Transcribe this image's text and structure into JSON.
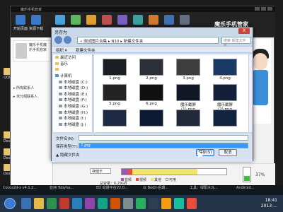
{
  "desktop": {
    "icons": [
      "Desk",
      "Desk",
      "Desk",
      "QQN"
    ]
  },
  "manager": {
    "topbar_text": "魔乐手机管家",
    "title": "魔乐手机管家",
    "tools": [
      "开始页面",
      "资源下载",
      "",
      "",
      "",
      "",
      "",
      "",
      "",
      "",
      ""
    ],
    "phone_card": "魔乐手机魔乐手机管家",
    "groups": [
      "所有联系人",
      "未分组联系人"
    ],
    "storage_select": "存储卡",
    "capacity_text": "总容量：6.29GB",
    "storage_legend": [
      "音频",
      "视频",
      "其他",
      "可用"
    ],
    "storage_colors": [
      "#9b59b6",
      "#e74c3c",
      "#f1e46b",
      "#ffffff"
    ],
    "battery_pct": "37%",
    "battery_level": 0.37
  },
  "dialog": {
    "title": "另存为",
    "close": "X",
    "address": "« 测试图片合集 ▸ N10 ▸ 新建文件夹",
    "search_placeholder": "搜索 新建文件夹",
    "organize": "组织 ▾",
    "new_folder": "新建文件夹",
    "nav_items": [
      {
        "label": "最近访问",
        "kind": "folder",
        "sub": false
      },
      {
        "label": "音乐",
        "kind": "folder",
        "sub": false
      },
      {
        "label": "",
        "kind": "folder",
        "sub": false
      },
      {
        "label": "计算机",
        "kind": "pc",
        "sub": false
      },
      {
        "label": "本地磁盘 (C:)",
        "kind": "drive",
        "sub": true
      },
      {
        "label": "本地磁盘 (D:)",
        "kind": "drive",
        "sub": true
      },
      {
        "label": "本地磁盘 (E:)",
        "kind": "drive",
        "sub": true
      },
      {
        "label": "本地磁盘 (F:)",
        "kind": "drive",
        "sub": true
      },
      {
        "label": "本地磁盘 (G:)",
        "kind": "drive",
        "sub": true
      },
      {
        "label": "本地磁盘 (H:)",
        "kind": "drive",
        "sub": true
      },
      {
        "label": "本地磁盘 (I:)",
        "kind": "drive",
        "sub": true
      },
      {
        "label": "本地磁盘 (J:)",
        "kind": "drive",
        "sub": true
      }
    ],
    "files": [
      {
        "name": "1.png",
        "color": "#1b1e24"
      },
      {
        "name": "2.png",
        "color": "#2b2f37"
      },
      {
        "name": "3.png",
        "color": "#3d3d3d"
      },
      {
        "name": "4.png",
        "color": "#1a3a66"
      },
      {
        "name": "5.png",
        "color": "#222222"
      },
      {
        "name": "6.png",
        "color": "#111111"
      },
      {
        "name": "魔乐截屏(1).png",
        "color": "#101725"
      },
      {
        "name": "魔乐截屏(2).png",
        "color": "#14203a"
      },
      {
        "name": "",
        "color": "#1e2a44"
      },
      {
        "name": "",
        "color": "#0c1a33"
      },
      {
        "name": "",
        "color": "#20283a"
      },
      {
        "name": "",
        "color": "#10243f"
      }
    ],
    "filename_label": "文件名(N):",
    "filename_value": "7.jpg",
    "savetype_label": "保存类型(T):",
    "savetype_value": "",
    "hide_folders": "▲ 隐藏文件夹",
    "save_button": "保存(S)",
    "cancel_button": "取消"
  },
  "strip": [
    "Cocos2d-x v4.1.2...",
    "亚洲 Tobyha...",
    "ED 动漫平台V2.0...",
    "以 Bedit·后期...",
    "工具：绿阳木马...",
    "Andiroid..."
  ],
  "taskbar": {
    "time": "18:41",
    "date": "2013-..."
  }
}
